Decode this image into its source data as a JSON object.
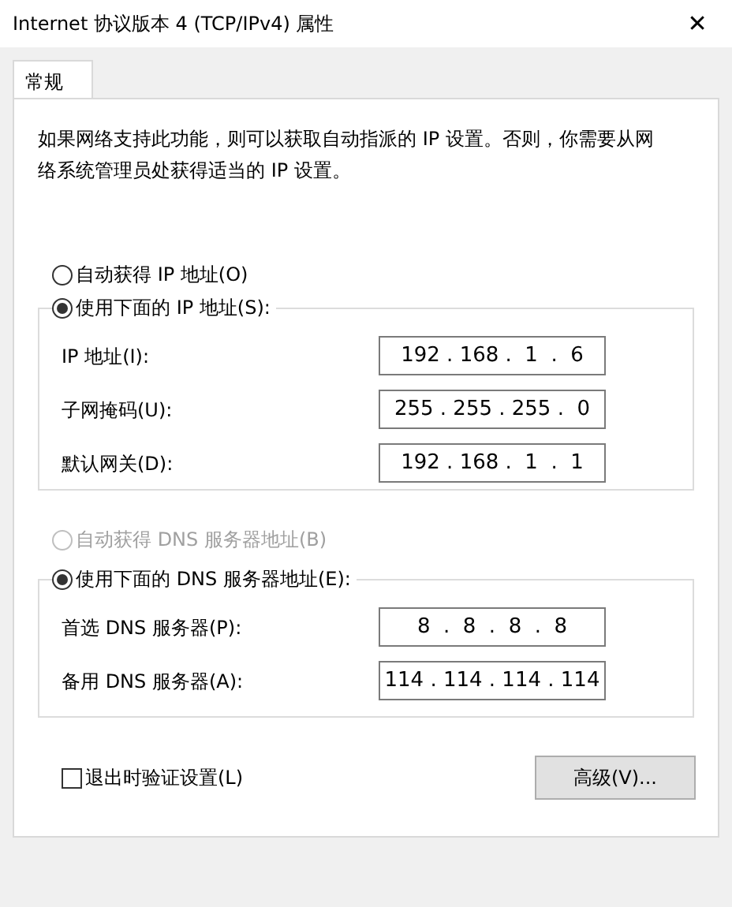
{
  "window": {
    "title": "Internet 协议版本 4 (TCP/IPv4) 属性",
    "close": "✕"
  },
  "tabs": [
    {
      "label": "常规",
      "selected": true
    }
  ],
  "description": "如果网络支持此功能，则可以获取自动指派的 IP 设置。否则，你需要从网络系统管理员处获得适当的 IP 设置。",
  "ip_mode": [
    {
      "label": "自动获得 IP 地址(O)",
      "selected": false,
      "disabled": false
    },
    {
      "label": "使用下面的 IP 地址(S):",
      "selected": true,
      "disabled": false
    }
  ],
  "ip_fields": [
    {
      "label": "IP 地址(I):",
      "value": "192 . 168 .  1  .  6"
    },
    {
      "label": "子网掩码(U):",
      "value": "255 . 255 . 255 .  0"
    },
    {
      "label": "默认网关(D):",
      "value": "192 . 168 .  1  .  1"
    }
  ],
  "dns_mode": [
    {
      "label": "自动获得 DNS 服务器地址(B)",
      "selected": false,
      "disabled": true
    },
    {
      "label": "使用下面的 DNS 服务器地址(E):",
      "selected": true,
      "disabled": false
    }
  ],
  "dns_fields": [
    {
      "label": "首选 DNS 服务器(P):",
      "value": "8  .  8  .  8  .  8"
    },
    {
      "label": "备用 DNS 服务器(A):",
      "value": "114 . 114 . 114 . 114"
    }
  ],
  "validate": {
    "label": "退出时验证设置(L)",
    "checked": false
  },
  "advanced_button": "高级(V)..."
}
